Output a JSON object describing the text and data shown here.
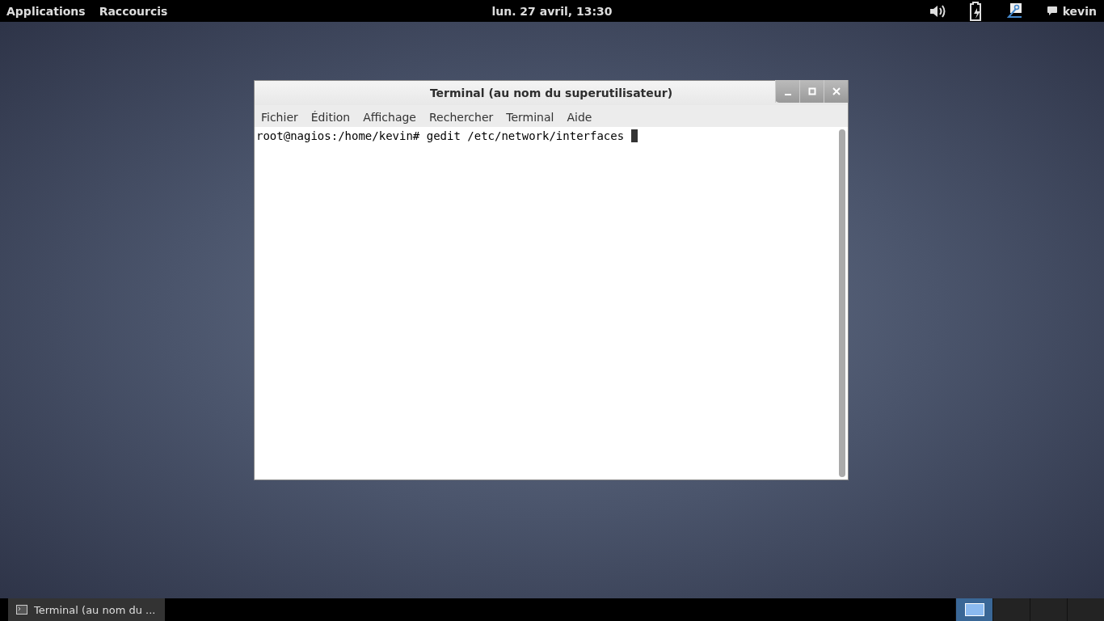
{
  "top_bar": {
    "menus": [
      "Applications",
      "Raccourcis"
    ],
    "clock": "lun. 27 avril, 13:30",
    "user": "kevin"
  },
  "window": {
    "title": "Terminal (au nom du superutilisateur)",
    "menu": [
      "Fichier",
      "Édition",
      "Affichage",
      "Rechercher",
      "Terminal",
      "Aide"
    ],
    "prompt": "root@nagios:/home/kevin# ",
    "command": "gedit /etc/network/interfaces "
  },
  "taskbar": {
    "tasks": [
      {
        "label": "Terminal (au nom du ...",
        "selected": true
      }
    ],
    "workspaces": [
      {
        "selected": true
      },
      {
        "selected": false
      },
      {
        "selected": false
      },
      {
        "selected": false
      }
    ]
  }
}
